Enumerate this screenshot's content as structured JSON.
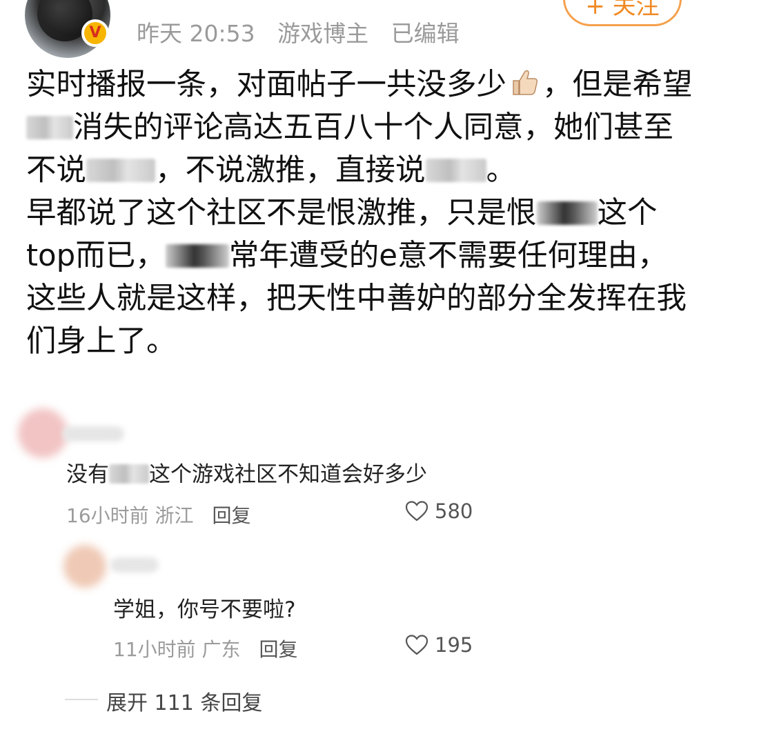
{
  "post": {
    "meta": {
      "time": "昨天 20:53",
      "author_tag": "游戏博主",
      "edited": "已编辑"
    },
    "follow_label": "+ 关注",
    "lines": {
      "l1a": "实时播报一条，对面帖子一共没多少",
      "l1b": "，但是希望",
      "l2": "消失的评论高达五百八十个人同意，她们甚至",
      "l3a": "不说",
      "l3b": "，不说激推，直接说",
      "l3c": "。",
      "l4a": "早都说了这个社区不是恨激推，只是恨",
      "l4b": "这个",
      "l5a": "top而已，",
      "l5b": "常年遭受的e意不需要任何理由，",
      "l6": "这些人就是这样，把天性中善妒的部分全发挥在我",
      "l7": "们身上了。"
    }
  },
  "comments": [
    {
      "text_a": "没有",
      "text_b": "这个游戏社区不知道会好多少",
      "time": "16小时前",
      "location": "浙江",
      "reply_label": "回复",
      "likes": "580"
    },
    {
      "text": "学姐，你号不要啦?",
      "time": "11小时前",
      "location": "广东",
      "reply_label": "回复",
      "likes": "195"
    }
  ],
  "expand_replies_label": "展开 111 条回复",
  "colors": {
    "accent": "#f08a24",
    "meta_gray": "#9a9a9a",
    "verified": "#f7b500"
  }
}
